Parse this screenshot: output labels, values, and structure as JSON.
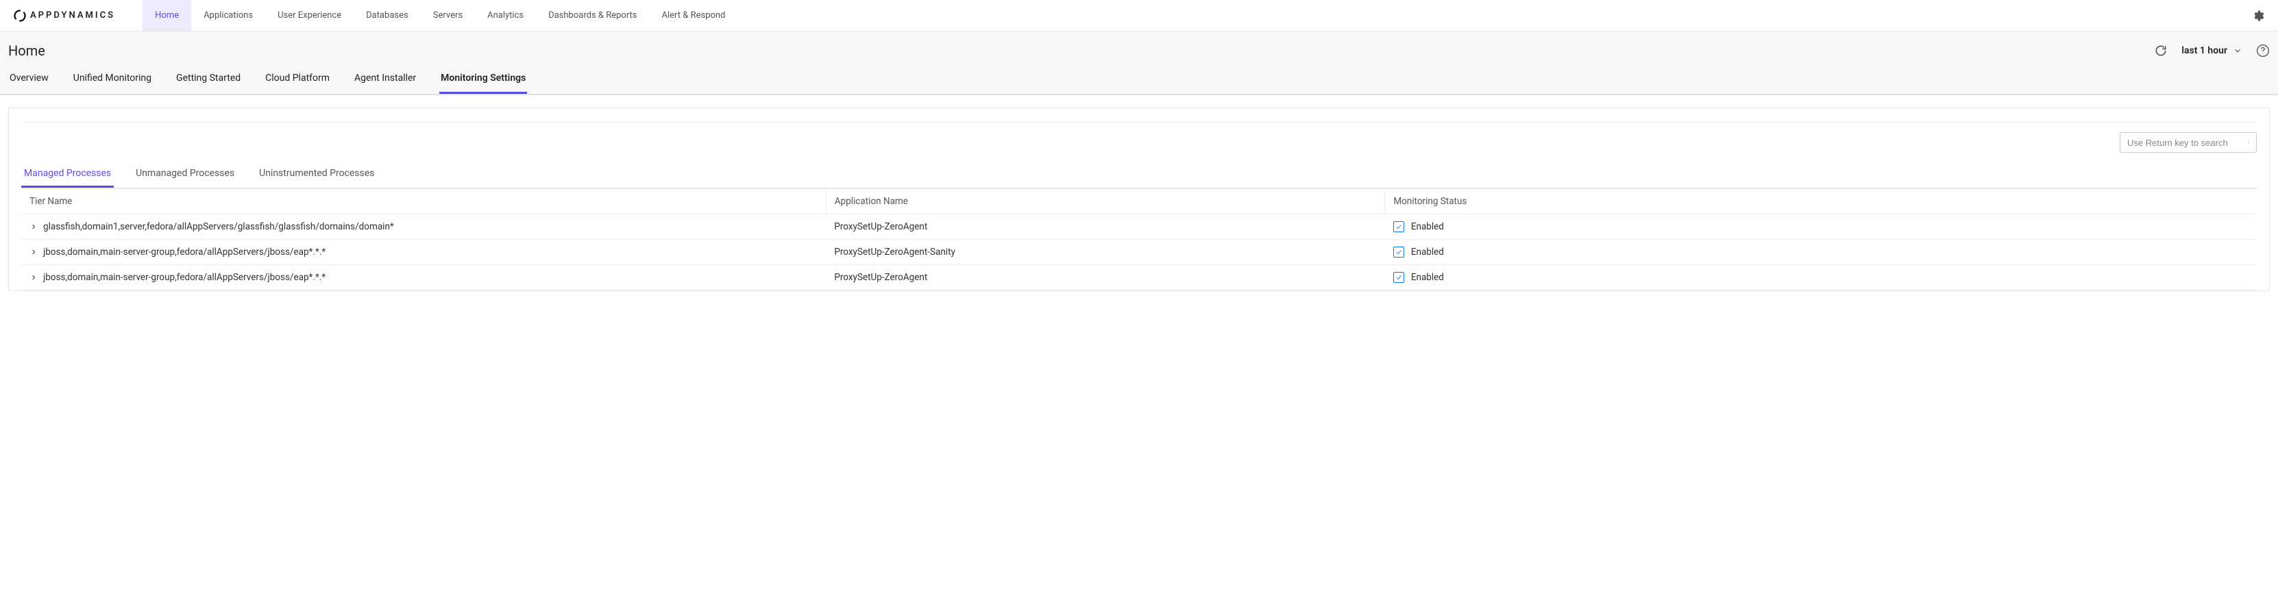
{
  "brand": {
    "name": "APPDYNAMICS"
  },
  "topnav": {
    "items": [
      {
        "label": "Home",
        "active": true
      },
      {
        "label": "Applications",
        "active": false
      },
      {
        "label": "User Experience",
        "active": false
      },
      {
        "label": "Databases",
        "active": false
      },
      {
        "label": "Servers",
        "active": false
      },
      {
        "label": "Analytics",
        "active": false
      },
      {
        "label": "Dashboards & Reports",
        "active": false
      },
      {
        "label": "Alert & Respond",
        "active": false
      }
    ]
  },
  "page": {
    "title": "Home",
    "time_range": "last 1 hour"
  },
  "subtabs": [
    {
      "label": "Overview",
      "active": false
    },
    {
      "label": "Unified Monitoring",
      "active": false
    },
    {
      "label": "Getting Started",
      "active": false
    },
    {
      "label": "Cloud Platform",
      "active": false
    },
    {
      "label": "Agent Installer",
      "active": false
    },
    {
      "label": "Monitoring Settings",
      "active": true
    }
  ],
  "search": {
    "placeholder": "Use Return key to search"
  },
  "inner_tabs": [
    {
      "label": "Managed Processes",
      "active": true
    },
    {
      "label": "Unmanaged Processes",
      "active": false
    },
    {
      "label": "Uninstrumented Processes",
      "active": false
    }
  ],
  "table": {
    "columns": {
      "tier": "Tier Name",
      "app": "Application Name",
      "status": "Monitoring Status"
    },
    "rows": [
      {
        "tier": "glassfish,domain1,server,fedora/allAppServers/glassfish/glassfish/domains/domain*",
        "app": "ProxySetUp-ZeroAgent",
        "status": "Enabled",
        "checked": true
      },
      {
        "tier": "jboss,domain,main-server-group,fedora/allAppServers/jboss/eap*.*.*",
        "app": "ProxySetUp-ZeroAgent-Sanity",
        "status": "Enabled",
        "checked": true
      },
      {
        "tier": "jboss,domain,main-server-group,fedora/allAppServers/jboss/eap*.*.*",
        "app": "ProxySetUp-ZeroAgent",
        "status": "Enabled",
        "checked": true
      }
    ]
  }
}
